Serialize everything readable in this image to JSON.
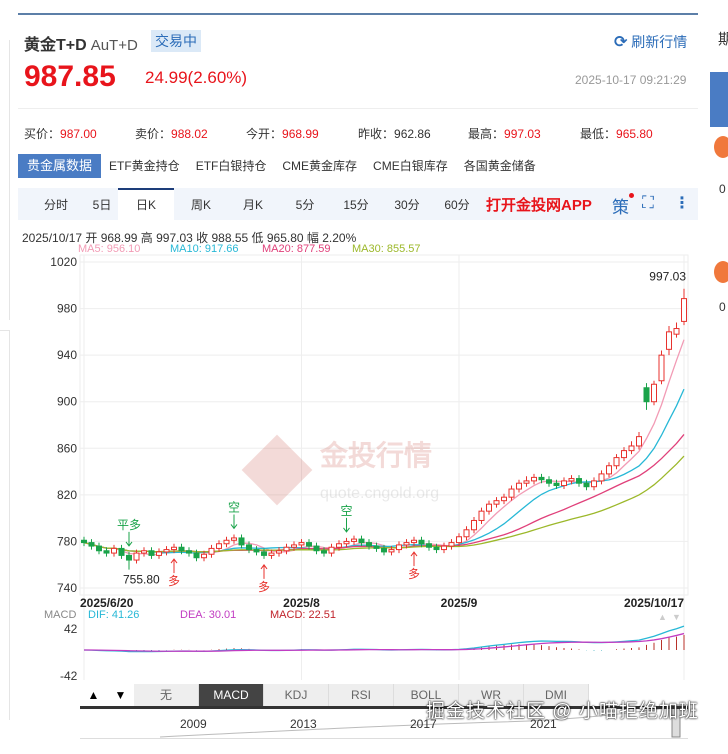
{
  "header": {
    "name": "黄金T+D",
    "code": "AuT+D",
    "status": "交易中",
    "refresh": "刷新行情",
    "price": "987.85",
    "change": "24.99(2.60%)",
    "time": "2025-10-17 09:21:29"
  },
  "quotes": [
    {
      "label": "买价：",
      "value": "987.00",
      "red": true
    },
    {
      "label": "卖价：",
      "value": "988.02",
      "red": true
    },
    {
      "label": "今开：",
      "value": "968.99",
      "red": true
    },
    {
      "label": "昨收：",
      "value": "962.86",
      "red": false
    },
    {
      "label": "最高：",
      "value": "997.03",
      "red": true
    },
    {
      "label": "最低：",
      "value": "965.80",
      "red": true
    }
  ],
  "data_tabs": [
    "贵金属数据",
    "ETF黄金持仓",
    "ETF白银持仓",
    "CME黄金库存",
    "CME白银库存",
    "各国黄金储备"
  ],
  "k_tabs": [
    "分时",
    "5日",
    "日K",
    "周K",
    "月K",
    "5分",
    "15分",
    "30分",
    "60分"
  ],
  "k_tab_active": "日K",
  "app_link": "打开金投网APP",
  "strategy": "策",
  "info": "2025/10/17  开 968.99  高 997.03  收 988.55  低 965.80  幅 2.20%",
  "ma": [
    {
      "label": "MA5: 956.10",
      "color": "#f29bb5"
    },
    {
      "label": "MA10: 917.66",
      "color": "#27b8d6"
    },
    {
      "label": "MA20: 877.59",
      "color": "#e0407a"
    },
    {
      "label": "MA30: 855.57",
      "color": "#9cb82a"
    }
  ],
  "macd": {
    "title": "MACD",
    "dif": "DIF: 41.26",
    "dea": "DEA: 30.01",
    "macd": "MACD: 22.51",
    "y_top": "42",
    "y_bottom": "-42"
  },
  "bottom_tabs": [
    "无",
    "MACD",
    "KDJ",
    "RSI",
    "BOLL",
    "WR",
    "DMI"
  ],
  "bottom_active": "MACD",
  "navigator_years": [
    "2009",
    "2013",
    "2017",
    "2021"
  ],
  "watermark_logo": "金投行情 quote.cngold.org",
  "watermark": "掘金技术社区 @ 小喵拒绝加班",
  "right_panel": {
    "label": "期",
    "v1": "0",
    "v2": "0"
  },
  "colors": {
    "up": "#e8322d",
    "down": "#1aa34a",
    "accent": "#4a7cc4"
  },
  "chart_data": {
    "type": "candlestick",
    "ylim": [
      740,
      1020
    ],
    "yticks": [
      "1020",
      "980",
      "940",
      "900",
      "860",
      "820",
      "780",
      "740"
    ],
    "xticks": [
      {
        "label": "2025/6/20",
        "i": 0
      },
      {
        "label": "2025/8",
        "i": 29
      },
      {
        "label": "2025/9",
        "i": 50
      },
      {
        "label": "2025/10/17",
        "i": 80
      }
    ],
    "max_label": "997.03",
    "annotations": [
      {
        "i": 6,
        "text": "平多",
        "dir": "down"
      },
      {
        "i": 20,
        "text": "空",
        "dir": "down"
      },
      {
        "i": 35,
        "text": "空",
        "dir": "down"
      },
      {
        "i": 12,
        "text": "多",
        "dir": "up"
      },
      {
        "i": 24,
        "text": "多",
        "dir": "up"
      },
      {
        "i": 44,
        "text": "多",
        "dir": "up"
      }
    ],
    "ohlc": [
      [
        781,
        784,
        776,
        779
      ],
      [
        779,
        782,
        773,
        776
      ],
      [
        776,
        779,
        769,
        772
      ],
      [
        772,
        775,
        767,
        770
      ],
      [
        770,
        777,
        767,
        774
      ],
      [
        774,
        777,
        765,
        768
      ],
      [
        768,
        771,
        755.8,
        764
      ],
      [
        764,
        773,
        761,
        770
      ],
      [
        770,
        775,
        767,
        772
      ],
      [
        772,
        775,
        765,
        768
      ],
      [
        768,
        774,
        765,
        771
      ],
      [
        771,
        776,
        768,
        773
      ],
      [
        773,
        778,
        770,
        775
      ],
      [
        775,
        778,
        769,
        772
      ],
      [
        772,
        775,
        767,
        770
      ],
      [
        770,
        773,
        763,
        766
      ],
      [
        766,
        772,
        763,
        769
      ],
      [
        769,
        777,
        766,
        774
      ],
      [
        774,
        781,
        771,
        778
      ],
      [
        778,
        784,
        775,
        781
      ],
      [
        781,
        786,
        778,
        783
      ],
      [
        783,
        786,
        774,
        777
      ],
      [
        777,
        780,
        770,
        773
      ],
      [
        773,
        776,
        768,
        771
      ],
      [
        771,
        774,
        765,
        768
      ],
      [
        768,
        773,
        765,
        770
      ],
      [
        770,
        775,
        767,
        772
      ],
      [
        772,
        778,
        769,
        775
      ],
      [
        775,
        780,
        772,
        777
      ],
      [
        777,
        782,
        774,
        779
      ],
      [
        779,
        782,
        773,
        776
      ],
      [
        776,
        779,
        769,
        772
      ],
      [
        772,
        775,
        767,
        770
      ],
      [
        770,
        778,
        767,
        775
      ],
      [
        775,
        781,
        772,
        778
      ],
      [
        778,
        783,
        775,
        780
      ],
      [
        780,
        785,
        777,
        782
      ],
      [
        782,
        785,
        776,
        779
      ],
      [
        779,
        782,
        773,
        776
      ],
      [
        776,
        779,
        771,
        774
      ],
      [
        774,
        777,
        768,
        771
      ],
      [
        771,
        776,
        768,
        773
      ],
      [
        773,
        780,
        770,
        777
      ],
      [
        777,
        782,
        774,
        779
      ],
      [
        779,
        784,
        776,
        781
      ],
      [
        781,
        784,
        775,
        778
      ],
      [
        778,
        781,
        772,
        775
      ],
      [
        775,
        778,
        770,
        773
      ],
      [
        773,
        779,
        770,
        776
      ],
      [
        776,
        782,
        773,
        779
      ],
      [
        779,
        787,
        776,
        784
      ],
      [
        784,
        793,
        781,
        790
      ],
      [
        790,
        801,
        787,
        798
      ],
      [
        798,
        809,
        795,
        806
      ],
      [
        806,
        815,
        803,
        812
      ],
      [
        812,
        818,
        809,
        815
      ],
      [
        815,
        821,
        812,
        818
      ],
      [
        818,
        828,
        815,
        825
      ],
      [
        825,
        833,
        822,
        830
      ],
      [
        830,
        836,
        827,
        832
      ],
      [
        832,
        838,
        829,
        835
      ],
      [
        835,
        838,
        830,
        833
      ],
      [
        833,
        836,
        827,
        830
      ],
      [
        830,
        833,
        825,
        828
      ],
      [
        828,
        835,
        825,
        832
      ],
      [
        832,
        837,
        829,
        834
      ],
      [
        834,
        837,
        827,
        830
      ],
      [
        830,
        833,
        824,
        827
      ],
      [
        827,
        835,
        824,
        832
      ],
      [
        832,
        841,
        829,
        838
      ],
      [
        838,
        848,
        835,
        845
      ],
      [
        845,
        855,
        842,
        852
      ],
      [
        852,
        861,
        849,
        858
      ],
      [
        858,
        866,
        855,
        862
      ],
      [
        862,
        874,
        859,
        870
      ],
      [
        912,
        916,
        893,
        900
      ],
      [
        900,
        918,
        897,
        915
      ],
      [
        918,
        944,
        915,
        940
      ],
      [
        945,
        965,
        940,
        960
      ],
      [
        958,
        968,
        955,
        962.86
      ],
      [
        968.99,
        997.03,
        965.8,
        988.55
      ]
    ]
  }
}
